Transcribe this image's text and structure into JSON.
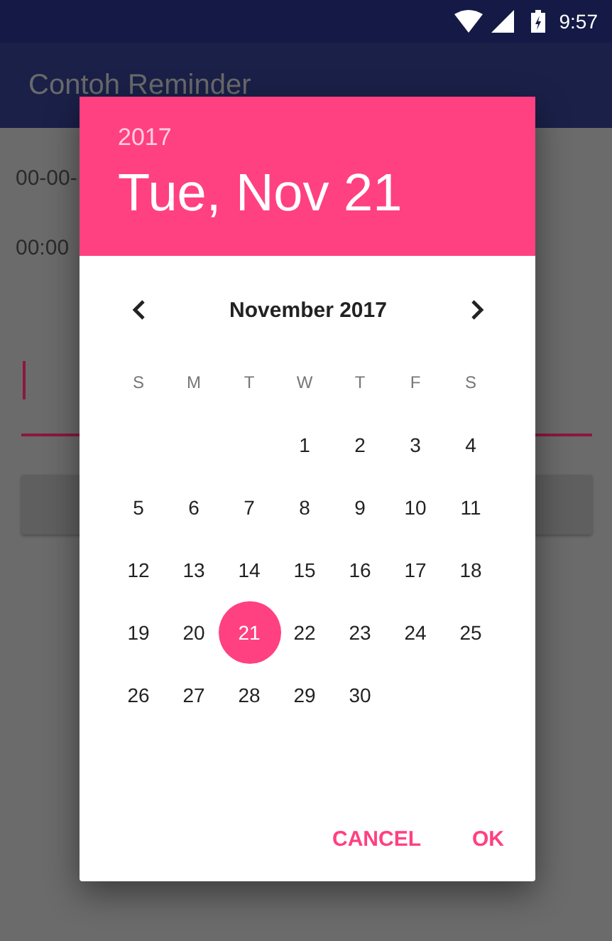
{
  "status_bar": {
    "time": "9:57"
  },
  "app_bar": {
    "title": "Contoh Reminder"
  },
  "form": {
    "date_text": "00-00-",
    "time_text": "00:00"
  },
  "dialog": {
    "year": "2017",
    "date_title": "Tue, Nov 21",
    "month_label": "November 2017",
    "weekdays": [
      "S",
      "M",
      "T",
      "W",
      "T",
      "F",
      "S"
    ],
    "weeks": [
      [
        {
          "kind": "blank"
        },
        {
          "kind": "blank"
        },
        {
          "kind": "blank"
        },
        {
          "kind": "day",
          "day": "1",
          "selected": false
        },
        {
          "kind": "day",
          "day": "2",
          "selected": false
        },
        {
          "kind": "day",
          "day": "3",
          "selected": false
        },
        {
          "kind": "day",
          "day": "4",
          "selected": false
        }
      ],
      [
        {
          "kind": "day",
          "day": "5",
          "selected": false
        },
        {
          "kind": "day",
          "day": "6",
          "selected": false
        },
        {
          "kind": "day",
          "day": "7",
          "selected": false
        },
        {
          "kind": "day",
          "day": "8",
          "selected": false
        },
        {
          "kind": "day",
          "day": "9",
          "selected": false
        },
        {
          "kind": "day",
          "day": "10",
          "selected": false
        },
        {
          "kind": "day",
          "day": "11",
          "selected": false
        }
      ],
      [
        {
          "kind": "day",
          "day": "12",
          "selected": false
        },
        {
          "kind": "day",
          "day": "13",
          "selected": false
        },
        {
          "kind": "day",
          "day": "14",
          "selected": false
        },
        {
          "kind": "day",
          "day": "15",
          "selected": false
        },
        {
          "kind": "day",
          "day": "16",
          "selected": false
        },
        {
          "kind": "day",
          "day": "17",
          "selected": false
        },
        {
          "kind": "day",
          "day": "18",
          "selected": false
        }
      ],
      [
        {
          "kind": "day",
          "day": "19",
          "selected": false
        },
        {
          "kind": "day",
          "day": "20",
          "selected": false
        },
        {
          "kind": "day",
          "day": "21",
          "selected": true
        },
        {
          "kind": "day",
          "day": "22",
          "selected": false
        },
        {
          "kind": "day",
          "day": "23",
          "selected": false
        },
        {
          "kind": "day",
          "day": "24",
          "selected": false
        },
        {
          "kind": "day",
          "day": "25",
          "selected": false
        }
      ],
      [
        {
          "kind": "day",
          "day": "26",
          "selected": false
        },
        {
          "kind": "day",
          "day": "27",
          "selected": false
        },
        {
          "kind": "day",
          "day": "28",
          "selected": false
        },
        {
          "kind": "day",
          "day": "29",
          "selected": false
        },
        {
          "kind": "day",
          "day": "30",
          "selected": false
        }
      ]
    ],
    "buttons": [
      "CANCEL",
      "OK"
    ]
  }
}
